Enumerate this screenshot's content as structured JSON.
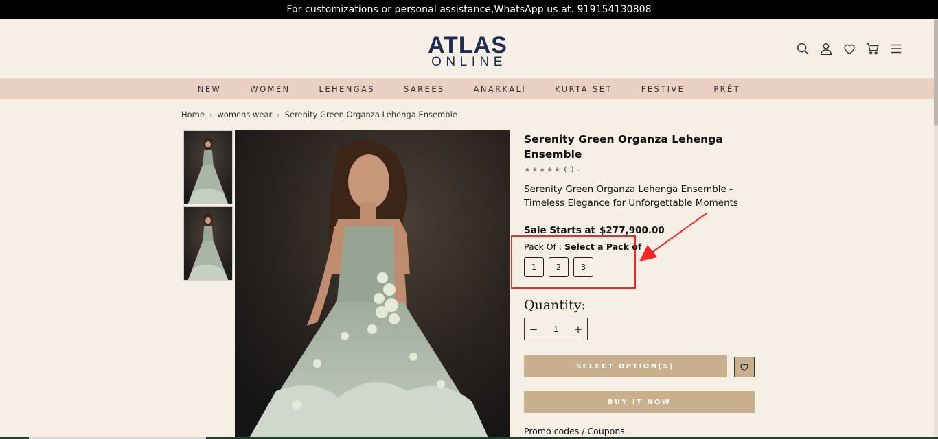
{
  "announcement": "For customizations or personal assistance,WhatsApp us at. 919154130808",
  "logo": {
    "top": "ATLAS",
    "bottom": "ONLINE"
  },
  "header_icons": [
    "search-icon",
    "account-icon",
    "wishlist-icon",
    "cart-icon",
    "menu-icon"
  ],
  "nav": [
    "NEW",
    "WOMEN",
    "LEHENGAS",
    "SAREES",
    "ANARKALI",
    "KURTA SET",
    "FESTIVE",
    "PRÊT"
  ],
  "breadcrumb": [
    "Home",
    "womens wear",
    "Serenity Green Organza Lehenga Ensemble"
  ],
  "product": {
    "title": "Serenity Green Organza Lehenga Ensemble",
    "stars": "★★★★★",
    "rating_count": "(1)",
    "description": "Serenity Green Organza Lehenga Ensemble - Timeless Elegance for Unforgettable Moments",
    "price_label": "Sale Starts at",
    "price": "$277,900.00"
  },
  "pack": {
    "label": "Pack Of :",
    "selected": "Select a Pack of",
    "options": [
      "1",
      "2",
      "3"
    ]
  },
  "quantity": {
    "label": "Quantity:",
    "value": "1",
    "minus": "−",
    "plus": "+"
  },
  "buttons": {
    "select_options": "SELECT OPTION(S)",
    "buy_now": "BUY IT NOW"
  },
  "promo": "Promo codes / Coupons",
  "colors": {
    "accent": "#c8b08d",
    "nav_bg": "#eacfc3",
    "page_bg": "#f6efe6",
    "highlight": "#ff2424"
  }
}
